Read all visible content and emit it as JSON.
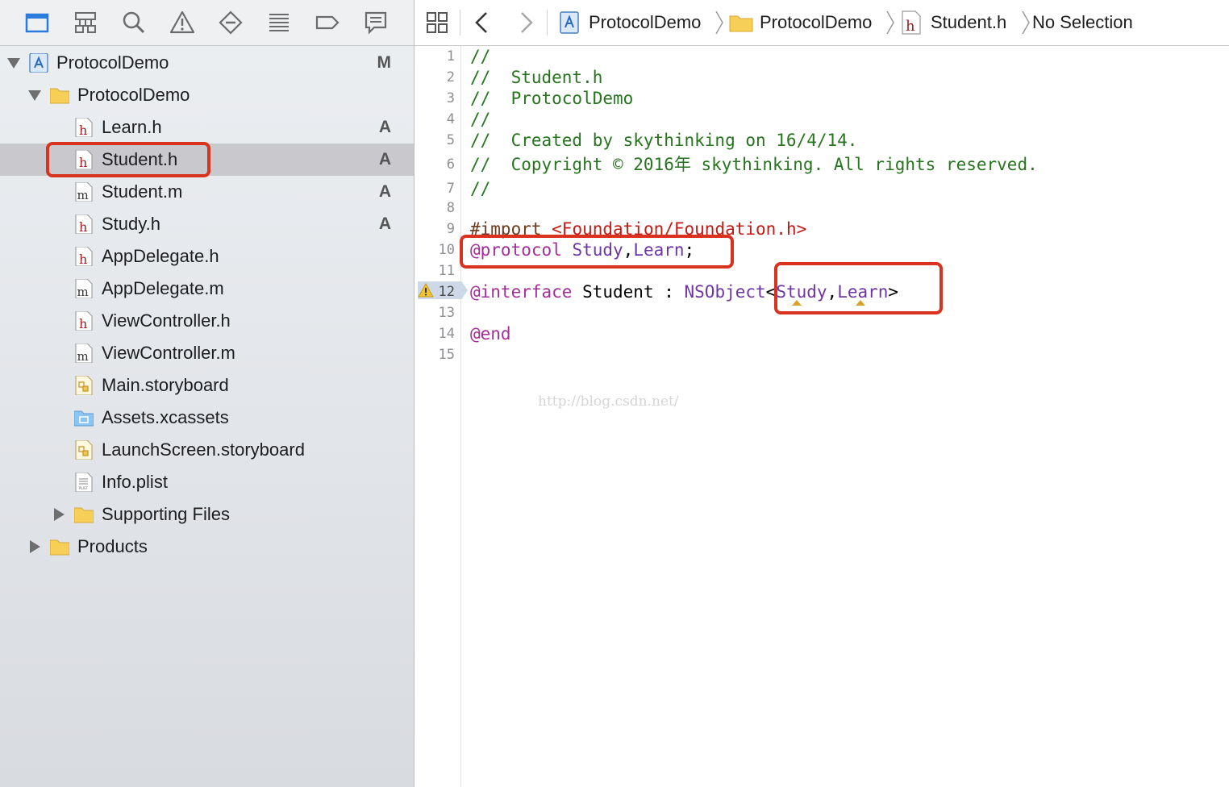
{
  "navigator": {
    "toolbar_icons": [
      "folder-icon",
      "hierarchy-icon",
      "search-icon",
      "warning-icon",
      "test-diamond-icon",
      "debug-list-icon",
      "breakpoint-icon",
      "report-icon"
    ],
    "tree": [
      {
        "label": "ProtocolDemo",
        "icon": "project-icon",
        "indent": 0,
        "disclosure": "open",
        "status": "M"
      },
      {
        "label": "ProtocolDemo",
        "icon": "folder-icon",
        "indent": 1,
        "disclosure": "open",
        "status": ""
      },
      {
        "label": "Learn.h",
        "icon": "header-file-icon",
        "indent": 2,
        "status": "A"
      },
      {
        "label": "Student.h",
        "icon": "header-file-icon",
        "indent": 2,
        "status": "A",
        "selected": true
      },
      {
        "label": "Student.m",
        "icon": "implementation-file-icon",
        "indent": 2,
        "status": "A"
      },
      {
        "label": "Study.h",
        "icon": "header-file-icon",
        "indent": 2,
        "status": "A"
      },
      {
        "label": "AppDelegate.h",
        "icon": "header-file-icon",
        "indent": 2,
        "status": ""
      },
      {
        "label": "AppDelegate.m",
        "icon": "implementation-file-icon",
        "indent": 2,
        "status": ""
      },
      {
        "label": "ViewController.h",
        "icon": "header-file-icon",
        "indent": 2,
        "status": ""
      },
      {
        "label": "ViewController.m",
        "icon": "implementation-file-icon",
        "indent": 2,
        "status": ""
      },
      {
        "label": "Main.storyboard",
        "icon": "storyboard-icon",
        "indent": 2,
        "status": ""
      },
      {
        "label": "Assets.xcassets",
        "icon": "assets-folder-icon",
        "indent": 2,
        "status": ""
      },
      {
        "label": "LaunchScreen.storyboard",
        "icon": "storyboard-icon",
        "indent": 2,
        "status": ""
      },
      {
        "label": "Info.plist",
        "icon": "plist-icon",
        "indent": 2,
        "status": ""
      },
      {
        "label": "Supporting Files",
        "icon": "folder-icon",
        "indent": 2,
        "disclosure": "closed",
        "status": ""
      },
      {
        "label": "Products",
        "icon": "folder-icon",
        "indent": 1,
        "disclosure": "closed",
        "status": ""
      }
    ]
  },
  "jump_bar": {
    "project": "ProtocolDemo",
    "group": "ProtocolDemo",
    "file": "Student.h",
    "selection": "No Selection"
  },
  "editor": {
    "line_numbers": [
      "1",
      "2",
      "3",
      "4",
      "5",
      "6",
      "7",
      "8",
      "9",
      "10",
      "11",
      "12",
      "13",
      "14",
      "15"
    ],
    "warning_line": "12",
    "lines": [
      {
        "no": "1",
        "tokens": [
          {
            "t": "//",
            "c": "comment"
          }
        ]
      },
      {
        "no": "2",
        "tokens": [
          {
            "t": "//  Student.h",
            "c": "comment"
          }
        ]
      },
      {
        "no": "3",
        "tokens": [
          {
            "t": "//  ProtocolDemo",
            "c": "comment"
          }
        ]
      },
      {
        "no": "4",
        "tokens": [
          {
            "t": "//",
            "c": "comment"
          }
        ]
      },
      {
        "no": "5",
        "tokens": [
          {
            "t": "//  Created by skythinking on 16/4/14.",
            "c": "comment"
          }
        ]
      },
      {
        "no": "6",
        "tokens": [
          {
            "t": "//  Copyright © 2016年 skythinking. All rights reserved.",
            "c": "comment"
          }
        ]
      },
      {
        "no": "7",
        "tokens": [
          {
            "t": "//",
            "c": "comment"
          }
        ]
      },
      {
        "no": "8",
        "tokens": []
      },
      {
        "no": "9",
        "tokens": [
          {
            "t": "#import ",
            "c": "pre"
          },
          {
            "t": "<Foundation/Foundation.h>",
            "c": "str"
          }
        ]
      },
      {
        "no": "10",
        "tokens": [
          {
            "t": "@protocol",
            "c": "kw"
          },
          {
            "t": " Study",
            "c": "type"
          },
          {
            "t": ",",
            "c": "plain"
          },
          {
            "t": "Learn",
            "c": "type"
          },
          {
            "t": ";",
            "c": "plain"
          }
        ]
      },
      {
        "no": "11",
        "tokens": []
      },
      {
        "no": "12",
        "tokens": [
          {
            "t": "@interface",
            "c": "kw"
          },
          {
            "t": " Student : ",
            "c": "plain"
          },
          {
            "t": "NSObject",
            "c": "type"
          },
          {
            "t": "<",
            "c": "plain"
          },
          {
            "t": "Study",
            "c": "type"
          },
          {
            "t": ",",
            "c": "plain"
          },
          {
            "t": "Learn",
            "c": "type"
          },
          {
            "t": ">",
            "c": "plain"
          }
        ]
      },
      {
        "no": "13",
        "tokens": []
      },
      {
        "no": "14",
        "tokens": [
          {
            "t": "@end",
            "c": "kw"
          }
        ]
      },
      {
        "no": "15",
        "tokens": []
      }
    ]
  },
  "watermark": "http://blog.csdn.net/",
  "colors": {
    "annotation_red": "#d9321e",
    "comment_green": "#26741d",
    "keyword_purple": "#a42d9b",
    "type_purple": "#6e35a8",
    "string_red": "#c41a16",
    "selected_row": "#c9c8cc",
    "folder_yellow": "#f6cf57"
  }
}
